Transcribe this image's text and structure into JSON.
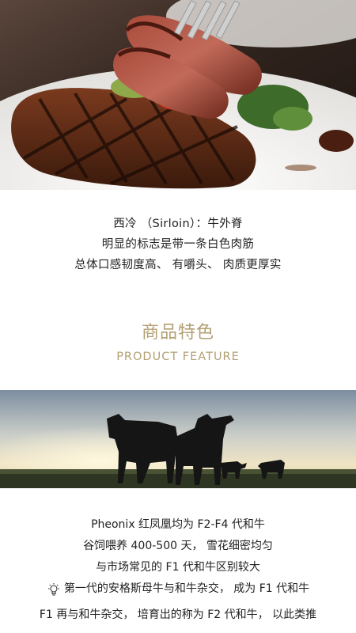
{
  "intro": {
    "line1": "西冷 （Sirloin）：牛外脊",
    "line2": "明显的标志是带一条白色肉筋",
    "line3": "总体口感韧度高、 有嚼头、 肉质更厚实"
  },
  "feature": {
    "title_cn": "商品特色",
    "title_en": "PRODUCT FEATURE"
  },
  "description": {
    "line1": "Pheonix 红凤凰均为 F2-F4 代和牛",
    "line2": "谷饲喂养 400-500 天， 雪花细密均匀",
    "line3": "与市场常见的 F1 代和牛区别较大",
    "line4": "第一代的安格斯母牛与和牛杂交， 成为 F1 代和牛",
    "line5": "F1 再与和牛杂交， 培育出的称为 F2 代和牛， 以此类推"
  },
  "icons": {
    "tip": "lightbulb-icon"
  },
  "colors": {
    "accent": "#b3a074",
    "text": "#222222"
  }
}
